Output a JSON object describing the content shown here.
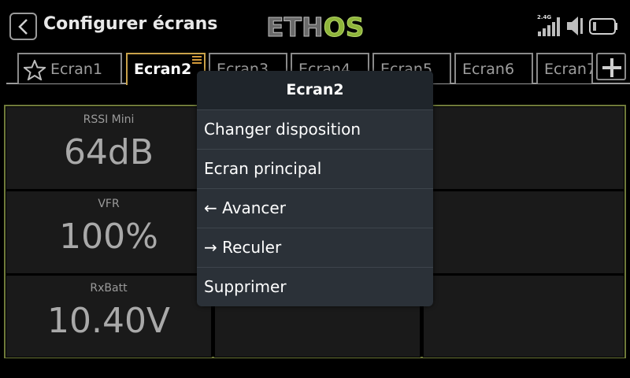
{
  "header": {
    "title": "Configurer écrans",
    "logo_part1": "ETH",
    "logo_part2": "OS",
    "rssi_label": "2.4G",
    "colors": {
      "logo_green": "#8fb53a",
      "accent": "#c9a24a"
    }
  },
  "tabs": [
    {
      "label": "Ecran1"
    },
    {
      "label": "Ecran2"
    },
    {
      "label": "Ecran3"
    },
    {
      "label": "Ecran4"
    },
    {
      "label": "Ecran5"
    },
    {
      "label": "Ecran6"
    },
    {
      "label": "Ecran7"
    }
  ],
  "widgets": [
    {
      "label": "RSSI Mini",
      "value": "64dB"
    },
    {
      "label": "VFR",
      "value": "100%"
    },
    {
      "label": "RxBatt",
      "value": "10.40V"
    }
  ],
  "popup": {
    "title": "Ecran2",
    "items": [
      "Changer disposition",
      "Ecran principal",
      "← Avancer",
      "→ Reculer",
      "Supprimer"
    ]
  }
}
